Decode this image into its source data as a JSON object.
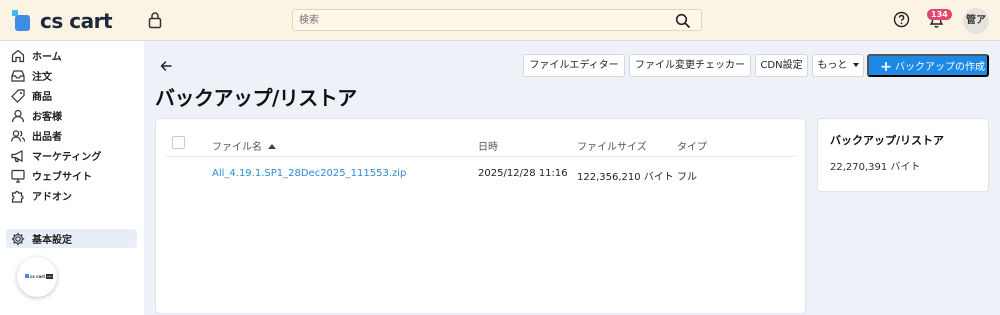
{
  "app": {
    "logo_text": "cs cart",
    "accent_color": "#1e88e5",
    "topbar_color": "#fbf3e4"
  },
  "search": {
    "placeholder": "検索"
  },
  "header": {
    "notification_count": "134",
    "avatar_text": "管ア"
  },
  "sidebar": {
    "items": [
      {
        "label": "ホーム",
        "icon": "home-icon"
      },
      {
        "label": "注文",
        "icon": "inbox-icon"
      },
      {
        "label": "商品",
        "icon": "tag-icon"
      },
      {
        "label": "お客様",
        "icon": "user-icon"
      },
      {
        "label": "出品者",
        "icon": "users-icon"
      },
      {
        "label": "マーケティング",
        "icon": "megaphone-icon"
      },
      {
        "label": "ウェブサイト",
        "icon": "monitor-icon"
      },
      {
        "label": "アドオン",
        "icon": "puzzle-icon"
      },
      {
        "label": "基本設定",
        "icon": "gear-icon"
      }
    ],
    "promo_logo": "cs cart"
  },
  "toolbar": {
    "file_editor": "ファイルエディター",
    "file_change_checker": "ファイル変更チェッカー",
    "cdn_settings": "CDN設定",
    "more": "もっと",
    "create_backup": "バックアップの作成"
  },
  "page": {
    "title": "バックアップ/リストア"
  },
  "table": {
    "columns": [
      "ファイル名",
      "日時",
      "ファイルサイズ",
      "タイプ"
    ],
    "rows": [
      {
        "filename": "All_4.19.1.SP1_28Dec2025_111553.zip",
        "datetime": "2025/12/28 11:16",
        "size": "122,356,210 バイト",
        "type": "フル"
      }
    ]
  },
  "summary": {
    "title": "バックアップ/リストア",
    "total_size": "22,270,391 バイト"
  }
}
